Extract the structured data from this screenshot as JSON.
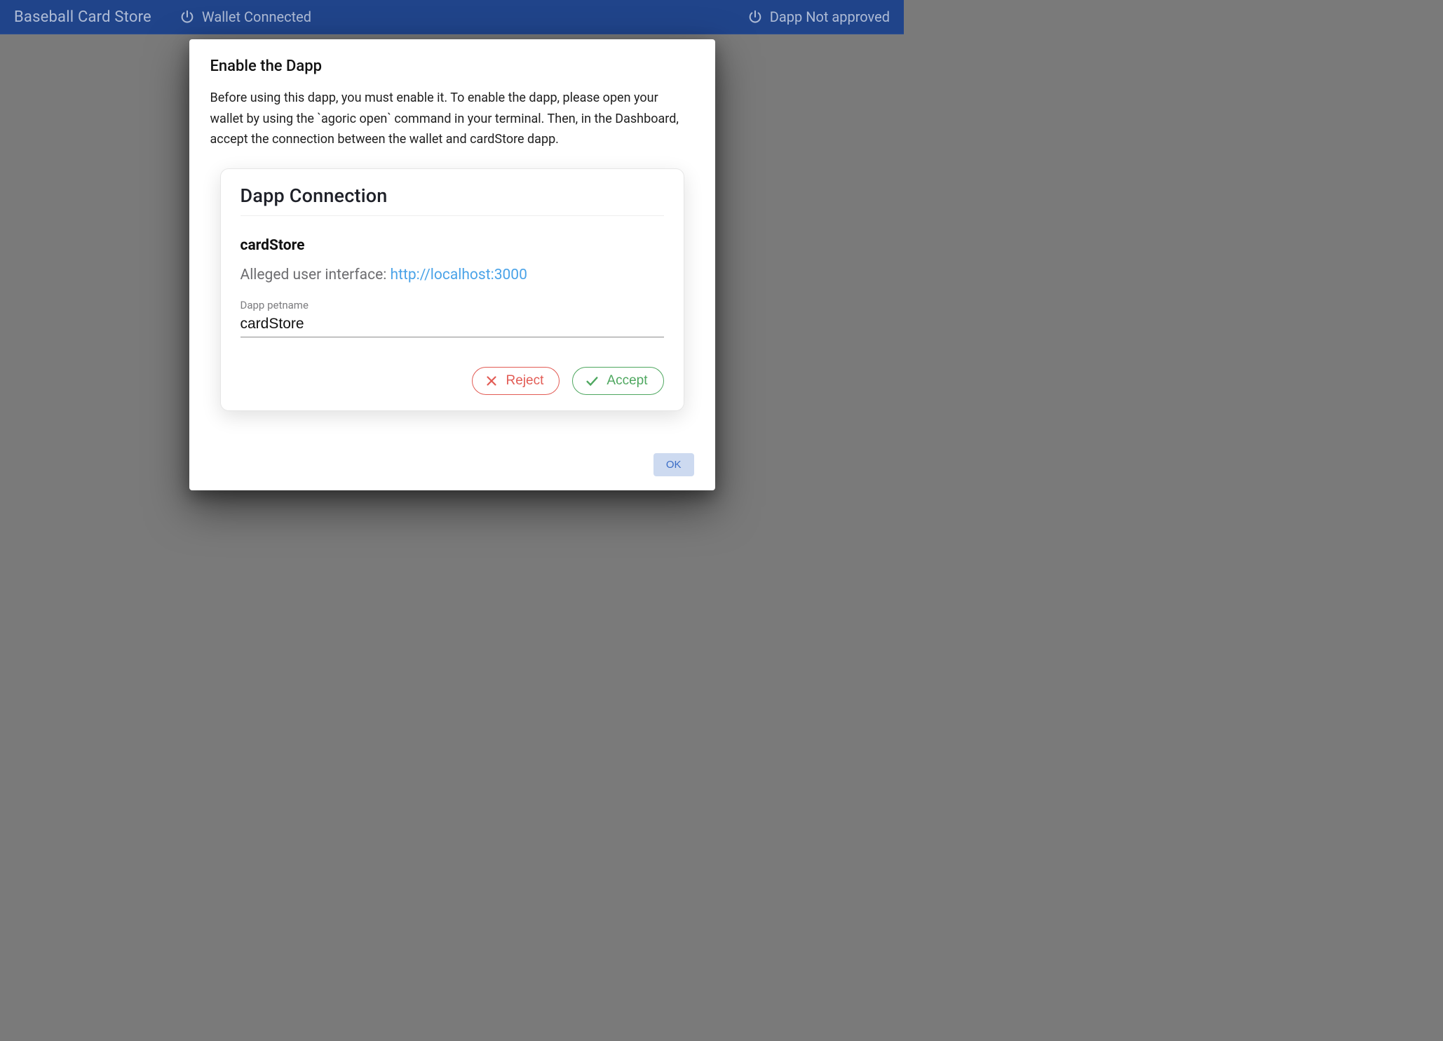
{
  "header": {
    "title": "Baseball Card Store",
    "wallet_status": "Wallet Connected",
    "dapp_status": "Dapp Not approved"
  },
  "dialog": {
    "title": "Enable the Dapp",
    "body": "Before using this dapp, you must enable it. To enable the dapp, please open your wallet by using the `agoric open` command in your terminal. Then, in the Dashboard, accept the connection between the wallet and cardStore dapp.",
    "ok_label": "OK"
  },
  "connection_card": {
    "title": "Dapp Connection",
    "dapp_name": "cardStore",
    "alleged_label": "Alleged user interface: ",
    "alleged_url": "http://localhost:3000",
    "petname_label": "Dapp petname",
    "petname_value": "cardStore",
    "reject_label": "Reject",
    "accept_label": "Accept"
  }
}
